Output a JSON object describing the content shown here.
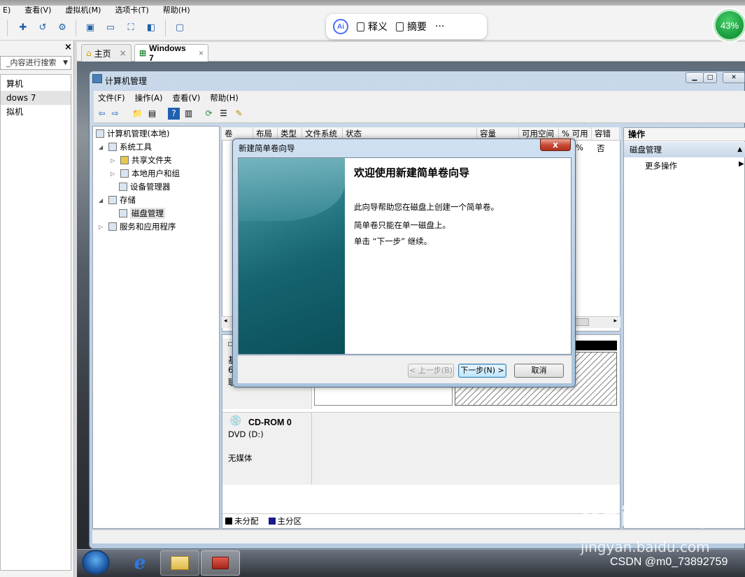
{
  "host": {
    "menu": [
      "E)",
      "查看(V)",
      "虚拟机(M)",
      "选项卡(T)",
      "帮助(H)"
    ],
    "ai_toolbar": {
      "logo": "Ai",
      "explain": "释义",
      "summary": "摘要",
      "more": "···"
    },
    "progress_percent": "43%",
    "library": {
      "close": "×",
      "search_placeholder": "_内容进行搜索",
      "items": [
        "算机",
        "dows 7",
        "拟机"
      ]
    },
    "tabs": [
      {
        "label": "主页",
        "close": "×"
      },
      {
        "label": "Windows 7",
        "close": "×"
      }
    ]
  },
  "cm": {
    "title": "计算机管理",
    "menu": [
      "文件(F)",
      "操作(A)",
      "查看(V)",
      "帮助(H)"
    ],
    "tree": {
      "root": "计算机管理(本地)",
      "system_tools": "系统工具",
      "shared_folders": "共享文件夹",
      "local_users": "本地用户和组",
      "device_manager": "设备管理器",
      "storage": "存储",
      "disk_management": "磁盘管理",
      "services": "服务和应用程序"
    },
    "columns": [
      "卷",
      "布局",
      "类型",
      "文件系统",
      "状态",
      "容量",
      "可用空间",
      "% 可用",
      "容错"
    ],
    "row_partial": {
      "pct_free": "%",
      "fault_tolerance": "否"
    },
    "disk0_partial": {
      "line1": "基",
      "line2": "6",
      "line3": "联"
    },
    "cdrom": {
      "name": "CD-ROM 0",
      "type": "DVD (D:)",
      "media": "无媒体"
    },
    "legend": {
      "unallocated": "未分配",
      "primary": "主分区"
    },
    "actions": {
      "header": "操作",
      "section": "磁盘管理",
      "more": "更多操作"
    }
  },
  "wizard": {
    "title": "新建简单卷向导",
    "close": "x",
    "heading": "欢迎使用新建简单卷向导",
    "line1": "此向导帮助您在磁盘上创建一个简单卷。",
    "line2": "简单卷只能在单一磁盘上。",
    "line3": "单击 “下一步” 继续。",
    "back": "< 上一步(B)",
    "next": "下一步(N) >",
    "cancel": "取消"
  },
  "watermarks": {
    "baidu": "Baidu经验",
    "jingyan": "jingyan.baidu.com",
    "csdn": "CSDN @m0_73892759"
  }
}
